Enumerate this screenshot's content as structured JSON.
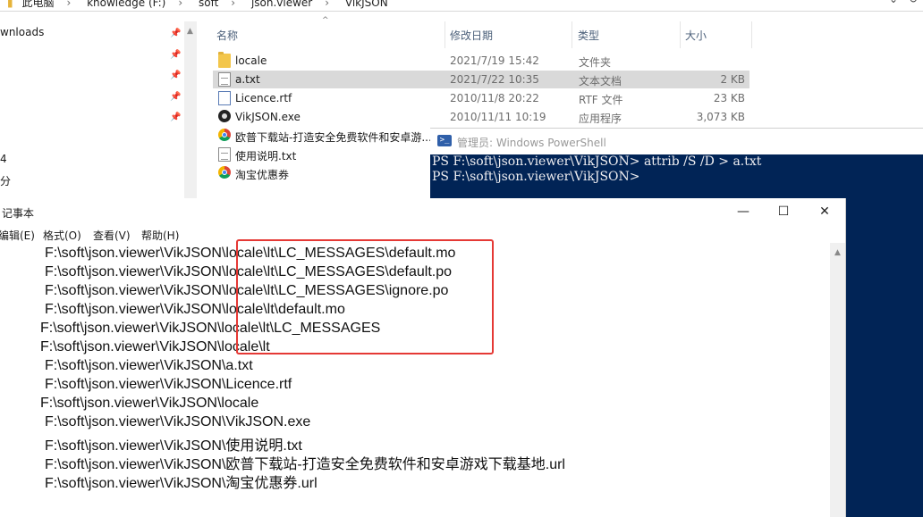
{
  "explorer": {
    "breadcrumb": [
      "此电脑",
      "knowledge (F:)",
      "soft",
      "json.viewer",
      "VikJSON"
    ],
    "nav_items": [
      {
        "label": "wnloads",
        "pinned": true
      },
      {
        "label": "",
        "pinned": true
      },
      {
        "label": "",
        "pinned": true
      },
      {
        "label": "",
        "pinned": true
      },
      {
        "label": "",
        "pinned": true
      },
      {
        "label": "4",
        "pinned": false
      },
      {
        "label": "分",
        "pinned": false
      }
    ],
    "columns": {
      "name": "名称",
      "date": "修改日期",
      "type": "类型",
      "size": "大小"
    },
    "files": [
      {
        "name": "locale",
        "date": "2021/7/19 15:42",
        "type": "文件夹",
        "size": "",
        "icon": "folder-icon",
        "selected": false
      },
      {
        "name": "a.txt",
        "date": "2021/7/22 10:35",
        "type": "文本文档",
        "size": "2 KB",
        "icon": "text-file-icon",
        "selected": true
      },
      {
        "name": "Licence.rtf",
        "date": "2010/11/8 20:22",
        "type": "RTF 文件",
        "size": "23 KB",
        "icon": "rtf-file-icon",
        "selected": false
      },
      {
        "name": "VikJSON.exe",
        "date": "2010/11/11 10:19",
        "type": "应用程序",
        "size": "3,073 KB",
        "icon": "app-exe-icon",
        "selected": false
      },
      {
        "name": "欧普下载站-打造安全免费软件和安卓游...",
        "date": "",
        "type": "",
        "size": "",
        "icon": "url-shortcut-icon",
        "selected": false
      },
      {
        "name": "使用说明.txt",
        "date": "",
        "type": "",
        "size": "",
        "icon": "text-file-icon",
        "selected": false
      },
      {
        "name": "淘宝优惠券",
        "date": "",
        "type": "",
        "size": "",
        "icon": "url-shortcut-icon",
        "selected": false
      }
    ]
  },
  "powershell": {
    "title": "管理员: Windows PowerShell",
    "lines": [
      "PS F:\\soft\\json.viewer\\VikJSON> attrib /S /D > a.txt",
      "PS F:\\soft\\json.viewer\\VikJSON>"
    ],
    "bg_color": "#012456"
  },
  "notepad": {
    "title": "记事本",
    "menu": [
      "编辑(E)",
      "格式(O)",
      "查看(V)",
      "帮助(H)"
    ],
    "window_controls": {
      "minimize": "—",
      "maximize": "☐",
      "close": "✕"
    },
    "lines": [
      "F:\\soft\\json.viewer\\VikJSON\\locale\\lt\\LC_MESSAGES\\default.mo",
      "F:\\soft\\json.viewer\\VikJSON\\locale\\lt\\LC_MESSAGES\\default.po",
      "F:\\soft\\json.viewer\\VikJSON\\locale\\lt\\LC_MESSAGES\\ignore.po",
      "F:\\soft\\json.viewer\\VikJSON\\locale\\lt\\default.mo",
      "F:\\soft\\json.viewer\\VikJSON\\locale\\lt\\LC_MESSAGES",
      "F:\\soft\\json.viewer\\VikJSON\\locale\\lt",
      "F:\\soft\\json.viewer\\VikJSON\\a.txt",
      "F:\\soft\\json.viewer\\VikJSON\\Licence.rtf",
      "F:\\soft\\json.viewer\\VikJSON\\locale",
      "F:\\soft\\json.viewer\\VikJSON\\VikJSON.exe",
      "F:\\soft\\json.viewer\\VikJSON\\使用说明.txt",
      "F:\\soft\\json.viewer\\VikJSON\\欧普下载站-打造安全免费软件和安卓游戏下载基地.url",
      "F:\\soft\\json.viewer\\VikJSON\\淘宝优惠券.url"
    ],
    "highlight_color": "#e53935"
  }
}
